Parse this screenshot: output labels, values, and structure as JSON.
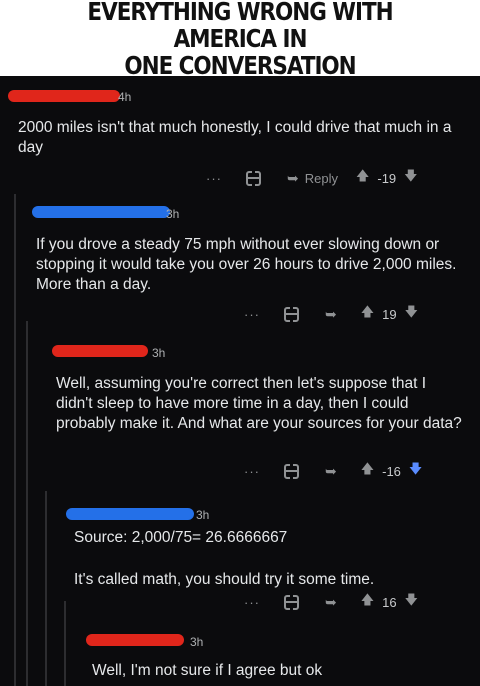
{
  "banner": {
    "title": "EVERYTHING WRONG WITH AMERICA IN\nONE CONVERSATION"
  },
  "colors": {
    "redaction_red": "#e0261b",
    "redaction_blue": "#2470e8",
    "downvote_active": "#5a8cff"
  },
  "icons": {
    "more": "ellipsis-icon",
    "award": "gift-icon",
    "reply": "reply-arrow-icon",
    "upvote": "upvote-arrow-icon",
    "downvote": "downvote-arrow-icon"
  },
  "comments": [
    {
      "time": "4h",
      "body": [
        "2000 miles isn't that much honestly, I could drive that much in a day"
      ],
      "actions": {
        "more": "···",
        "reply": "Reply",
        "score": "-19"
      }
    },
    {
      "time": "3h",
      "body": [
        "If you drove a steady 75 mph without ever slowing down or stopping it would take you over 26 hours to drive 2,000 miles. More than a day."
      ],
      "actions": {
        "more": "···",
        "score": "19"
      }
    },
    {
      "time": "3h",
      "body": [
        "Well, assuming you're correct then let's suppose that I didn't sleep to have more time in a day, then I could probably make it. And what are your sources for your data?"
      ],
      "actions": {
        "more": "···",
        "score": "-16"
      }
    },
    {
      "time": "3h",
      "body": [
        "Source: 2,000/75= 26.6666667",
        "It's called math, you should try it some time."
      ],
      "actions": {
        "more": "···",
        "score": "16"
      }
    },
    {
      "time": "3h",
      "body": [
        "Well, I'm not sure if I agree but ok"
      ]
    }
  ]
}
